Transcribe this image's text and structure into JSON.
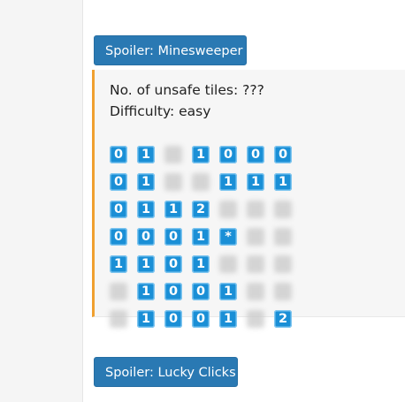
{
  "spoilers": {
    "minesweeper_label": "Spoiler: Minesweeper",
    "lucky_clicks_label": "Spoiler: Lucky Clicks"
  },
  "minesweeper": {
    "unsafe_tiles": "No. of unsafe tiles: ???",
    "difficulty": "Difficulty: easy",
    "grid": [
      [
        "0",
        "1",
        "",
        "1",
        "0",
        "0",
        "0"
      ],
      [
        "0",
        "1",
        "",
        "",
        "1",
        "1",
        "1"
      ],
      [
        "0",
        "1",
        "1",
        "2",
        "",
        "",
        ""
      ],
      [
        "0",
        "0",
        "0",
        "1",
        "*",
        "",
        ""
      ],
      [
        "1",
        "1",
        "0",
        "1",
        "",
        "",
        ""
      ],
      [
        "",
        "1",
        "0",
        "0",
        "1",
        "",
        ""
      ],
      [
        "",
        "1",
        "0",
        "0",
        "1",
        "",
        "2"
      ]
    ]
  },
  "colors": {
    "button_bg": "#2a79b3",
    "tile_bg": "#1a8fd6",
    "spoiler_border": "#f0a030"
  }
}
